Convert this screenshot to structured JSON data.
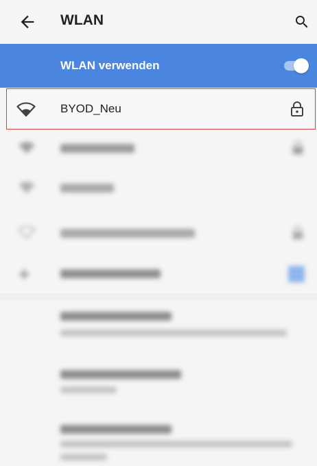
{
  "header": {
    "title": "WLAN",
    "back_icon": "arrow-back-icon",
    "search_icon": "search-icon"
  },
  "master_toggle": {
    "label": "WLAN verwenden",
    "state": "on",
    "bar_color": "#4a86e0"
  },
  "networks": [
    {
      "name": "BYOD_Neu",
      "secured": true,
      "highlighted": true
    }
  ]
}
